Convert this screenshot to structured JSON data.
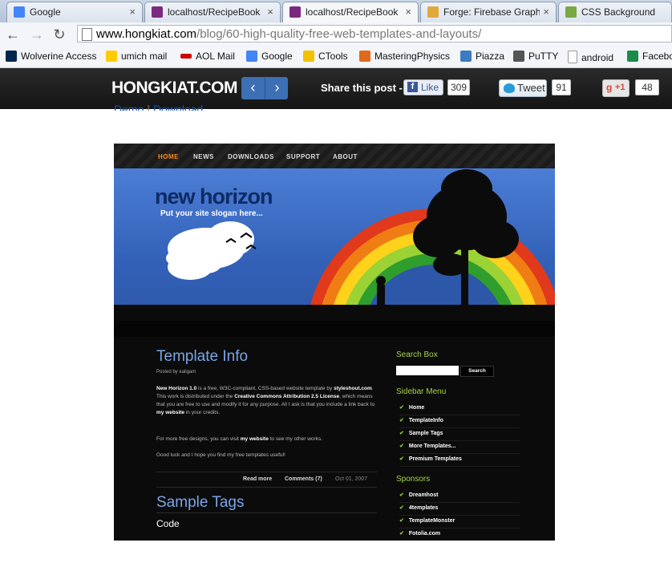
{
  "browser": {
    "tabs": [
      {
        "title": "Google",
        "close": "×",
        "color": "#4285f4"
      },
      {
        "title": "localhost/RecipeBook",
        "close": "×",
        "color": "#7b2a80"
      },
      {
        "title": "localhost/RecipeBook",
        "close": "×",
        "color": "#7b2a80"
      },
      {
        "title": "Forge: Firebase Graphi",
        "close": "×",
        "color": "#e1a93a"
      },
      {
        "title": "CSS Background",
        "close": "",
        "color": "#7aa842"
      }
    ],
    "back_icon": "back-arrow-icon",
    "forward_icon": "forward-arrow-icon",
    "reload_icon": "reload-icon",
    "url_domain": "www.hongkiat.com",
    "url_path": "/blog/60-high-quality-free-web-templates-and-layouts/"
  },
  "bookmarks": [
    {
      "label": "Wolverine Access",
      "color": "#00274c"
    },
    {
      "label": "umich mail",
      "color": "#ffcb05"
    },
    {
      "label": "AOL Mail",
      "color": "#cc0000"
    },
    {
      "label": "Google",
      "color": "#4285f4"
    },
    {
      "label": "CTools",
      "color": "#f2c200"
    },
    {
      "label": "MasteringPhysics",
      "color": "#e06a1b"
    },
    {
      "label": "Piazza",
      "color": "#3e7bbf"
    },
    {
      "label": "PuTTY",
      "color": "#555555"
    },
    {
      "label": "android",
      "color": "#dddddd"
    },
    {
      "label": "Facebo",
      "color": "#1b8a4a"
    }
  ],
  "site": {
    "logo": "HONGKIAT.COM",
    "prev": "‹",
    "next": "›",
    "share_label": "Share this post -",
    "fb_like": "Like",
    "fb_count": "309",
    "tweet": "Tweet",
    "tweet_count": "91",
    "gplus": "+1",
    "gplus_count": "48"
  },
  "article": {
    "demo": "Demo",
    "download": "Download",
    "sep": "|"
  },
  "preview": {
    "nav": [
      "HOME",
      "NEWS",
      "DOWNLOADS",
      "SUPPORT",
      "ABOUT"
    ],
    "title": "new horizon",
    "slogan": "Put your site slogan here...",
    "post_title": "Template Info",
    "post_meta": "Posted by ealigam",
    "post_p1_a": "New Horizon 1.0",
    "post_p1_b": " is a free, W3C-compliant, CSS-based website template by ",
    "post_p1_c": "styleshout.com",
    "post_p1_d": ". This work is distributed under the ",
    "post_p1_e": "Creative Commons Attribution 2.5 License",
    "post_p1_f": ", which means that you are free to use and modify it for any purpose. All I ask is that you include a link back to ",
    "post_p1_g": "my website",
    "post_p1_h": " in your credits.",
    "post_p2_a": "For more free designs, you can visit ",
    "post_p2_b": "my website",
    "post_p2_c": " to see my other works.",
    "post_p3": "Good luck and I hope you find my free templates useful!",
    "read_more": "Read more",
    "comments": "Comments (7)",
    "date": "Oct 01, 2007",
    "tags_title": "Sample Tags",
    "code": "Code",
    "search_box": "Search Box",
    "search_btn": "Search",
    "sidebar_menu": "Sidebar Menu",
    "menu_items": [
      "Home",
      "TemplateInfo",
      "Sample Tags",
      "More Templates...",
      "Premium Templates"
    ],
    "sponsors": "Sponsors",
    "sponsor_items": [
      "Dreamhost",
      "4templates",
      "TemplateMonster",
      "Fotolia.com"
    ]
  }
}
